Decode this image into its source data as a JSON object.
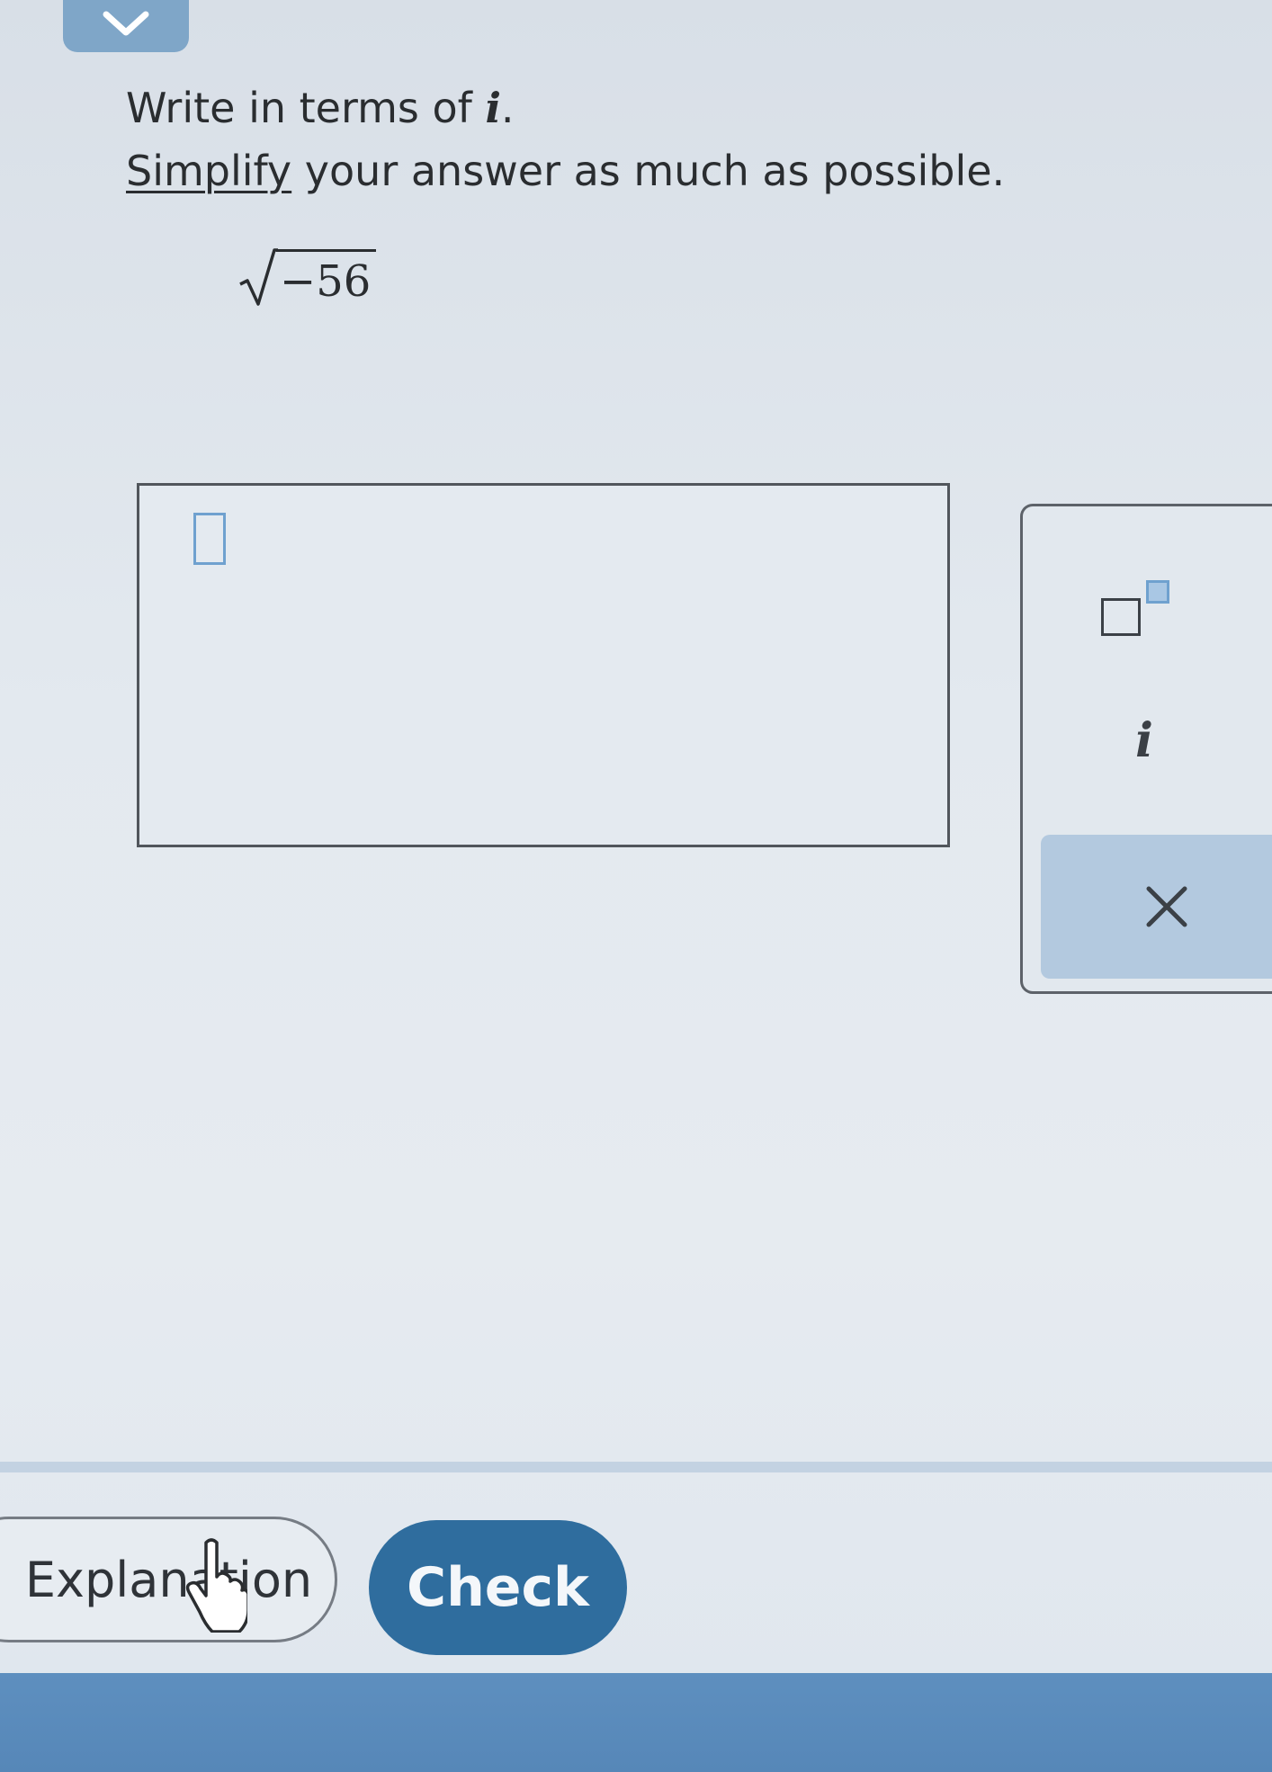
{
  "header": {
    "collapse_icon": "chevron-down-icon"
  },
  "question": {
    "line1_prefix": "Write in terms of ",
    "line1_var": "i",
    "line1_suffix": ".",
    "line2_link": "Simplify",
    "line2_rest": " your answer as much as possible.",
    "radicand": "−56"
  },
  "answer": {
    "value": ""
  },
  "keypad": {
    "superscript_icon": "superscript-template-icon",
    "i_key": "i",
    "clear_icon": "close-icon"
  },
  "footer": {
    "explanation_label": "Explanation",
    "check_label": "Check"
  },
  "colors": {
    "primary": "#2f6d9e",
    "accent": "#6fa1cf",
    "clear_key_bg": "#b3c9df"
  }
}
